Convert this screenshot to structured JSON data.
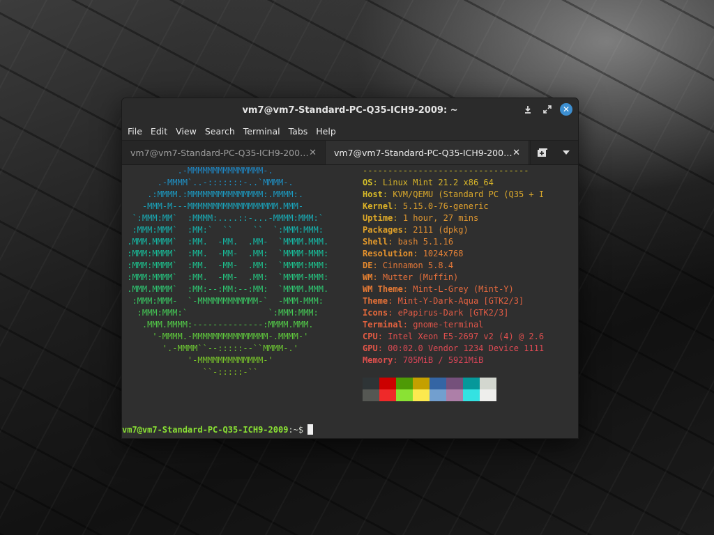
{
  "window": {
    "title": "vm7@vm7-Standard-PC-Q35-ICH9-2009: ~",
    "controls": {
      "minimize_icon": "download-icon",
      "maximize_icon": "maximize-icon",
      "close_icon": "close-icon"
    }
  },
  "menubar": {
    "items": [
      {
        "label": "File"
      },
      {
        "label": "Edit"
      },
      {
        "label": "View"
      },
      {
        "label": "Search"
      },
      {
        "label": "Terminal"
      },
      {
        "label": "Tabs"
      },
      {
        "label": "Help"
      }
    ]
  },
  "tabs": [
    {
      "label": "vm7@vm7-Standard-PC-Q35-ICH9-200…",
      "active": false
    },
    {
      "label": "vm7@vm7-Standard-PC-Q35-ICH9-200…",
      "active": true
    }
  ],
  "tab_actions": {
    "new_tab_icon": "new-tab-icon",
    "menu_icon": "chevron-down-icon"
  },
  "ascii_logo": [
    {
      "text": "           .-MMMMMMMMMMMMMMM-.",
      "color": "#1e88c6"
    },
    {
      "text": "       .-MMMM`..-:::::::-..`MMMM-.",
      "color": "#1f90c4"
    },
    {
      "text": "     .:MMMM.:MMMMMMMMMMMMMMM:.MMMM:.",
      "color": "#1c99c0"
    },
    {
      "text": "    -MMM-M---MMMMMMMMMMMMMMMMMM.MMM-",
      "color": "#1aa3bb"
    },
    {
      "text": "  `:MMM:MM`  :MMMM:....::-...-MMMM:MMM:`",
      "color": "#18abb5"
    },
    {
      "text": "  :MMM:MMM`  :MM:`  ``    ``  `:MMM:MMM:",
      "color": "#16b2ad"
    },
    {
      "text": " .MMM.MMMM`  :MM.  -MM.  .MM-  `MMMM.MMM.",
      "color": "#15b8a4"
    },
    {
      "text": " :MMM:MMMM`  :MM.  -MM-  .MM:  `MMMM-MMM:",
      "color": "#18bd99"
    },
    {
      "text": " :MMM:MMMM`  :MM.  -MM-  .MM:  `MMMM:MMM:",
      "color": "#1dc18d"
    },
    {
      "text": " :MMM:MMMM`  :MM.  -MM-  .MM:  `MMMM-MMM:",
      "color": "#25c47f"
    },
    {
      "text": " .MMM.MMMM`  :MM:--:MM:--:MM:  `MMMM.MMM.",
      "color": "#2ec771"
    },
    {
      "text": "  :MMM:MMM-  `-MMMMMMMMMMMM-`  -MMM-MMM:",
      "color": "#39c863"
    },
    {
      "text": "   :MMM:MMM:`                `:MMM:MMM:",
      "color": "#45c955"
    },
    {
      "text": "    .MMM.MMMM:--------------:MMMM.MMM.",
      "color": "#52c948"
    },
    {
      "text": "      '-MMMM.-MMMMMMMMMMMMMMM-.MMMM-'",
      "color": "#5fc83c"
    },
    {
      "text": "        '.-MMMM``--:::::--``MMMM-.'",
      "color": "#6cc732"
    },
    {
      "text": "             '-MMMMMMMMMMMMM-'",
      "color": "#78c52a"
    },
    {
      "text": "                ``-:::::-``",
      "color": "#84c423"
    }
  ],
  "sysinfo": {
    "separator": "---------------------------------",
    "lines": [
      {
        "key": "OS",
        "value": "Linux Mint 21.2 x86_64",
        "key_color": "#d4c02a",
        "value_color": "#d8b52a"
      },
      {
        "key": "Host",
        "value": "KVM/QEMU (Standard PC (Q35 + I",
        "key_color": "#d8ba28",
        "value_color": "#dcaa2c"
      },
      {
        "key": "Kernel",
        "value": "5.15.0-76-generic",
        "key_color": "#dbb127",
        "value_color": "#dfa12e"
      },
      {
        "key": "Uptime",
        "value": "1 hour, 27 mins",
        "key_color": "#dea928",
        "value_color": "#e19830"
      },
      {
        "key": "Packages",
        "value": "2111 (dpkg)",
        "key_color": "#e0a129",
        "value_color": "#e29032"
      },
      {
        "key": "Shell",
        "value": "bash 5.1.16",
        "key_color": "#e2992b",
        "value_color": "#e38834"
      },
      {
        "key": "Resolution",
        "value": "1024x768",
        "key_color": "#e4912d",
        "value_color": "#e48036"
      },
      {
        "key": "DE",
        "value": "Cinnamon 5.8.4",
        "key_color": "#e5892f",
        "value_color": "#e47838"
      },
      {
        "key": "WM",
        "value": "Mutter (Muffin)",
        "key_color": "#e68131",
        "value_color": "#e4703b"
      },
      {
        "key": "WM Theme",
        "value": "Mint-L-Grey (Mint-Y)",
        "key_color": "#e67934",
        "value_color": "#e4693e"
      },
      {
        "key": "Theme",
        "value": "Mint-Y-Dark-Aqua [GTK2/3]",
        "key_color": "#e67137",
        "value_color": "#e36241"
      },
      {
        "key": "Icons",
        "value": "ePapirus-Dark [GTK2/3]",
        "key_color": "#e5693b",
        "value_color": "#e25b45"
      },
      {
        "key": "Terminal",
        "value": "gnome-terminal",
        "key_color": "#e4623f",
        "value_color": "#e05549"
      },
      {
        "key": "CPU",
        "value": "Intel Xeon E5-2697 v2 (4) @ 2.6",
        "key_color": "#e35b43",
        "value_color": "#df4f4e"
      },
      {
        "key": "GPU",
        "value": "00:02.0 Vendor 1234 Device 1111",
        "key_color": "#e15548",
        "value_color": "#dd4a53"
      },
      {
        "key": "Memory",
        "value": "705MiB / 5921MiB",
        "key_color": "#de4f4d",
        "value_color": "#db4558"
      }
    ],
    "separator_color": "#d4c02a"
  },
  "palette": {
    "row1": [
      "#2e3436",
      "#cc0000",
      "#4e9a06",
      "#c4a000",
      "#3465a4",
      "#75507b",
      "#06989a",
      "#d3d7cf"
    ],
    "row2": [
      "#555753",
      "#ef2929",
      "#8ae234",
      "#fce94f",
      "#729fcf",
      "#ad7fa8",
      "#34e2e2",
      "#eeeeec"
    ]
  },
  "prompt": {
    "user_host": "vm7@vm7-Standard-PC-Q35-ICH9-2009",
    "path": ":~$"
  }
}
